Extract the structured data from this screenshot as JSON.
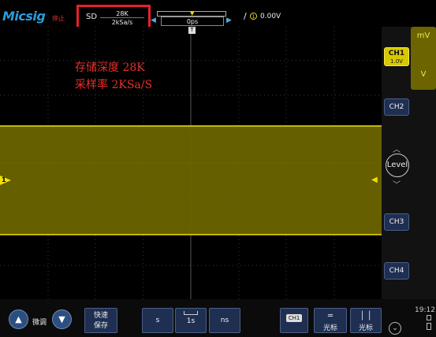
{
  "header": {
    "brand": "Micsig",
    "run_state": "停止",
    "sd": {
      "label": "SD",
      "depth": "28K",
      "rate": "2kSa/s"
    },
    "horizontal_position": "0ps",
    "trigger": {
      "source_label": "1",
      "level": "0.00V"
    }
  },
  "annotation": {
    "line1": "存储深度 28K",
    "line2": "采样率  2KSa/S"
  },
  "waveform": {
    "channel": "CH1",
    "marker_label": "1",
    "color": "#6b6400",
    "edge_color": "#f0e000"
  },
  "right_panel": {
    "unit_top": "mV",
    "unit_bottom": "V",
    "ch1": {
      "label": "CH1",
      "scale": "1.0V"
    },
    "ch2": "CH2",
    "ch3": "CH3",
    "ch4": "CH4",
    "level": "Level"
  },
  "bottom": {
    "fine_tune": "微调",
    "quick_save_line1": "快速",
    "quick_save_line2": "保存",
    "time_unit_s": "s",
    "time_value": "1s",
    "time_unit_ns": "ns",
    "ch1_chip": "CH1",
    "cursor_h": "光标",
    "cursor_v": "光标",
    "clock": "19:12"
  },
  "colors": {
    "accent_yellow": "#f0e000",
    "annotation_red": "#e8302a",
    "button_blue": "#1f2f52",
    "brand_blue": "#2a9bdc"
  }
}
